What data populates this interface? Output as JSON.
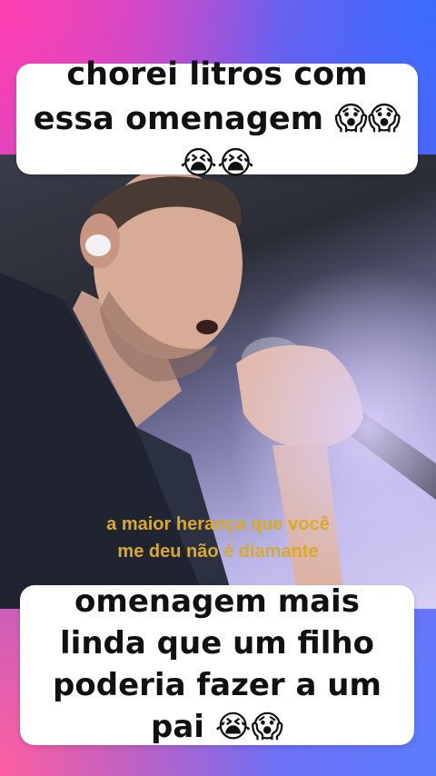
{
  "top_caption": "chorei litros com essa omenagem 😱😱😭😭",
  "video": {
    "subtitle_line1": "a maior herança que você",
    "subtitle_line2": "me deu não é diamante"
  },
  "bottom_caption": "omenagem mais linda que um filho poderia fazer a um pai 😭😱",
  "colors": {
    "subtitle": "#d8a92a",
    "card": "#ffffff",
    "shirt": "#1f2430",
    "microphone": "#2a2e38"
  }
}
